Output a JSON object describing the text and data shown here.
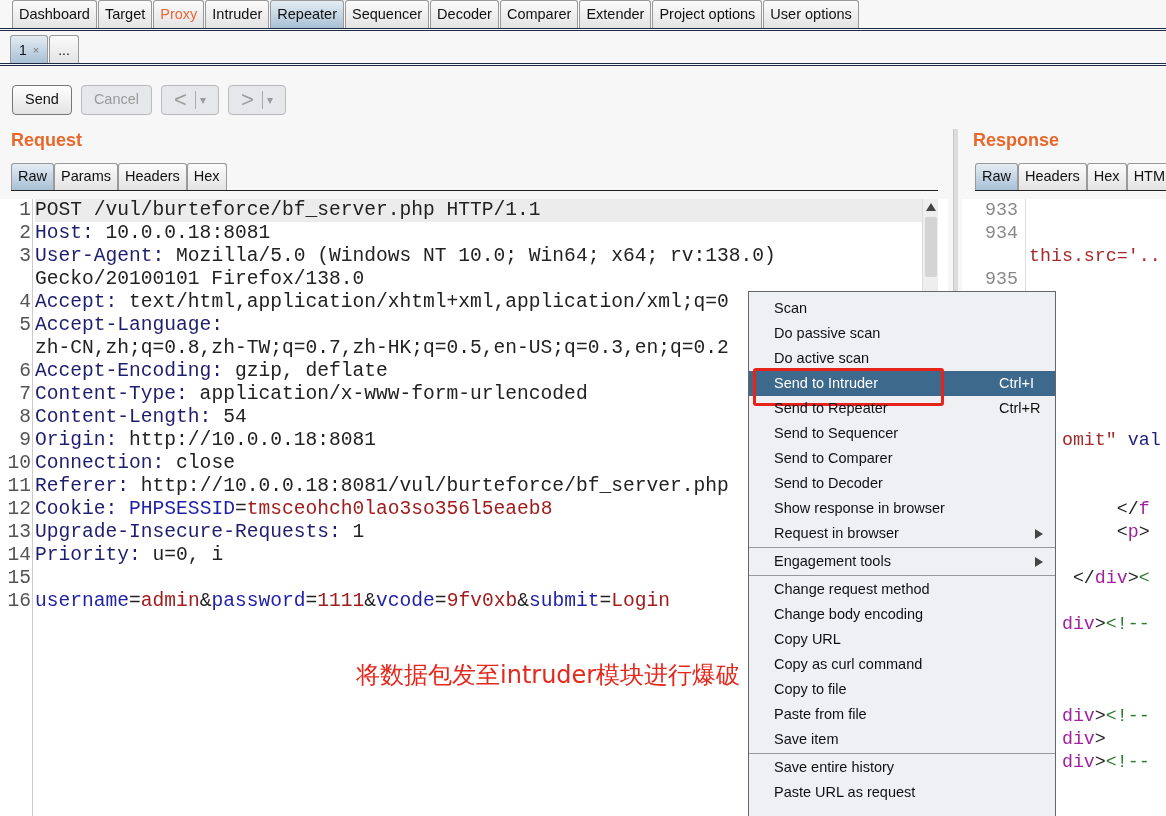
{
  "tabs": [
    {
      "label": "Dashboard",
      "selected": false,
      "highlighted": false
    },
    {
      "label": "Target",
      "selected": false,
      "highlighted": false
    },
    {
      "label": "Proxy",
      "selected": false,
      "highlighted": true
    },
    {
      "label": "Intruder",
      "selected": false,
      "highlighted": false
    },
    {
      "label": "Repeater",
      "selected": true,
      "highlighted": false
    },
    {
      "label": "Sequencer",
      "selected": false,
      "highlighted": false
    },
    {
      "label": "Decoder",
      "selected": false,
      "highlighted": false
    },
    {
      "label": "Comparer",
      "selected": false,
      "highlighted": false
    },
    {
      "label": "Extender",
      "selected": false,
      "highlighted": false
    },
    {
      "label": "Project options",
      "selected": false,
      "highlighted": false
    },
    {
      "label": "User options",
      "selected": false,
      "highlighted": false
    }
  ],
  "subtabs": [
    {
      "label": "1",
      "close": "×",
      "selected": true
    },
    {
      "label": "...",
      "selected": false
    }
  ],
  "toolbar": [
    {
      "kind": "text",
      "label": "Send",
      "disabled": false
    },
    {
      "kind": "text",
      "label": "Cancel",
      "disabled": true
    },
    {
      "kind": "split",
      "label": "<",
      "caret": "▾",
      "disabled": true
    },
    {
      "kind": "split",
      "label": ">",
      "caret": "▾",
      "disabled": true
    }
  ],
  "request": {
    "title": "Request",
    "tabs": [
      {
        "label": "Raw",
        "selected": true
      },
      {
        "label": "Params",
        "selected": false
      },
      {
        "label": "Headers",
        "selected": false
      },
      {
        "label": "Hex",
        "selected": false
      }
    ],
    "lines": [
      {
        "number": "1",
        "current": true,
        "segments": [
          {
            "kind": "plain",
            "text": "POST /vul/burteforce/bf_server.php HTTP/1.1"
          }
        ]
      },
      {
        "number": "2",
        "current": false,
        "segments": [
          {
            "kind": "header",
            "text": "Host:"
          },
          {
            "kind": "plain",
            "text": " 10.0.0.18:8081"
          }
        ]
      },
      {
        "number": "3",
        "current": false,
        "segments": [
          {
            "kind": "header",
            "text": "User-Agent:"
          },
          {
            "kind": "plain",
            "text": " Mozilla/5.0 (Windows NT 10.0; Win64; x64; rv:138.0)"
          }
        ]
      },
      {
        "current": false,
        "segments": [
          {
            "kind": "plain",
            "text": "Gecko/20100101 Firefox/138.0"
          }
        ]
      },
      {
        "number": "4",
        "current": false,
        "segments": [
          {
            "kind": "header",
            "text": "Accept:"
          },
          {
            "kind": "plain",
            "text": " text/html,application/xhtml+xml,application/xml;q=0"
          }
        ]
      },
      {
        "number": "5",
        "current": false,
        "segments": [
          {
            "kind": "header",
            "text": "Accept-Language:"
          }
        ]
      },
      {
        "current": false,
        "segments": [
          {
            "kind": "plain",
            "text": "zh-CN,zh;q=0.8,zh-TW;q=0.7,zh-HK;q=0.5,en-US;q=0.3,en;q=0.2"
          }
        ]
      },
      {
        "number": "6",
        "current": false,
        "segments": [
          {
            "kind": "header",
            "text": "Accept-Encoding:"
          },
          {
            "kind": "plain",
            "text": " gzip, deflate"
          }
        ]
      },
      {
        "number": "7",
        "current": false,
        "segments": [
          {
            "kind": "header",
            "text": "Content-Type:"
          },
          {
            "kind": "plain",
            "text": " application/x-www-form-urlencoded"
          }
        ]
      },
      {
        "number": "8",
        "current": false,
        "segments": [
          {
            "kind": "header",
            "text": "Content-Length:"
          },
          {
            "kind": "plain",
            "text": " 54"
          }
        ]
      },
      {
        "number": "9",
        "current": false,
        "segments": [
          {
            "kind": "header",
            "text": "Origin:"
          },
          {
            "kind": "plain",
            "text": " http://10.0.0.18:8081"
          }
        ]
      },
      {
        "number": "10",
        "current": false,
        "segments": [
          {
            "kind": "header",
            "text": "Connection:"
          },
          {
            "kind": "plain",
            "text": " close"
          }
        ]
      },
      {
        "number": "11",
        "current": false,
        "segments": [
          {
            "kind": "header",
            "text": "Referer:"
          },
          {
            "kind": "plain",
            "text": " http://10.0.0.18:8081/vul/burteforce/bf_server.php"
          }
        ]
      },
      {
        "number": "12",
        "current": false,
        "segments": [
          {
            "kind": "header",
            "text": "Cookie: "
          },
          {
            "kind": "param",
            "text": "PHPSESSID"
          },
          {
            "kind": "plain",
            "text": "="
          },
          {
            "kind": "value",
            "text": "tmsceohch0lao3so356l5eaeb8"
          }
        ]
      },
      {
        "number": "13",
        "current": false,
        "segments": [
          {
            "kind": "header",
            "text": "Upgrade-Insecure-Requests:"
          },
          {
            "kind": "plain",
            "text": " 1"
          }
        ]
      },
      {
        "number": "14",
        "current": false,
        "segments": [
          {
            "kind": "header",
            "text": "Priority:"
          },
          {
            "kind": "plain",
            "text": " u=0, i"
          }
        ]
      },
      {
        "number": "15",
        "current": false
      },
      {
        "number": "16",
        "current": false,
        "segments": [
          {
            "kind": "param",
            "text": "username"
          },
          {
            "kind": "plain",
            "text": "="
          },
          {
            "kind": "value",
            "text": "admin"
          },
          {
            "kind": "plain",
            "text": "&"
          },
          {
            "kind": "param",
            "text": "password"
          },
          {
            "kind": "plain",
            "text": "="
          },
          {
            "kind": "value",
            "text": "1111"
          },
          {
            "kind": "plain",
            "text": "&"
          },
          {
            "kind": "param",
            "text": "vcode"
          },
          {
            "kind": "plain",
            "text": "="
          },
          {
            "kind": "value",
            "text": "9fv0xb"
          },
          {
            "kind": "plain",
            "text": "&"
          },
          {
            "kind": "param",
            "text": "submit"
          },
          {
            "kind": "plain",
            "text": "="
          },
          {
            "kind": "value",
            "text": "Login"
          }
        ]
      }
    ]
  },
  "annotation": {
    "caption": "将数据包发至intruder模块进行爆破"
  },
  "response": {
    "title": "Response",
    "tabs": [
      {
        "label": "Raw",
        "selected": true
      },
      {
        "label": "Headers",
        "selected": false
      },
      {
        "label": "Hex",
        "selected": false
      },
      {
        "label": "HTM",
        "selected": false
      }
    ],
    "lines": [
      {
        "number": "933"
      },
      {
        "number": "934"
      },
      {
        "segments": [
          {
            "kind": "string",
            "text": "this.src='.."
          }
        ]
      },
      {
        "number": "935"
      },
      {
        "kind": "blank"
      },
      {
        "kind": "blank"
      },
      {
        "kind": "blank"
      },
      {
        "kind": "blank"
      },
      {
        "kind": "blank"
      },
      {
        "kind": "blank"
      },
      {
        "kind": "shallow",
        "segments": [
          {
            "kind": "string",
            "text": "omit\""
          },
          {
            "kind": "attr",
            "text": " val"
          }
        ]
      },
      {
        "kind": "blank"
      },
      {
        "kind": "blank"
      },
      {
        "kind": "deep",
        "segments": [
          {
            "kind": "plain",
            "text": "</"
          },
          {
            "kind": "tag",
            "text": "f"
          }
        ]
      },
      {
        "kind": "deep",
        "segments": [
          {
            "kind": "plain",
            "text": "<"
          },
          {
            "kind": "tag",
            "text": "p"
          },
          {
            "kind": "plain",
            "text": ">"
          }
        ]
      },
      {
        "kind": "blank"
      },
      {
        "kind": "mid",
        "segments": [
          {
            "kind": "plain",
            "text": "</"
          },
          {
            "kind": "tag",
            "text": "div"
          },
          {
            "kind": "plain",
            "text": ">"
          },
          {
            "kind": "comment",
            "text": "<"
          }
        ]
      },
      {
        "kind": "blank"
      },
      {
        "kind": "shallow",
        "segments": [
          {
            "kind": "tag",
            "text": "div"
          },
          {
            "kind": "plain",
            "text": ">"
          },
          {
            "kind": "comment",
            "text": "<!--"
          }
        ]
      },
      {
        "kind": "blank"
      },
      {
        "kind": "blank"
      },
      {
        "kind": "blank"
      },
      {
        "kind": "shallow",
        "segments": [
          {
            "kind": "tag",
            "text": "div"
          },
          {
            "kind": "plain",
            "text": ">"
          },
          {
            "kind": "comment",
            "text": "<!--"
          }
        ]
      },
      {
        "kind": "shallow",
        "segments": [
          {
            "kind": "tag",
            "text": "div"
          },
          {
            "kind": "plain",
            "text": ">"
          }
        ]
      },
      {
        "kind": "shallow",
        "segments": [
          {
            "kind": "tag",
            "text": "div"
          },
          {
            "kind": "plain",
            "text": ">"
          },
          {
            "kind": "comment",
            "text": "<!--"
          }
        ]
      }
    ]
  },
  "context_menu": {
    "groups": [
      {
        "items": [
          {
            "label": "Scan",
            "selected": false,
            "submenu": false,
            "annotated": false
          },
          {
            "label": "Do passive scan",
            "selected": false,
            "submenu": false,
            "annotated": false
          },
          {
            "label": "Do active scan",
            "selected": false,
            "submenu": false,
            "annotated": false
          },
          {
            "label": "Send to Intruder",
            "shortcut": "Ctrl+I",
            "selected": true,
            "submenu": false,
            "annotated": true
          },
          {
            "label": "Send to Repeater",
            "shortcut": "Ctrl+R",
            "selected": false,
            "submenu": false,
            "annotated": false
          },
          {
            "label": "Send to Sequencer",
            "selected": false,
            "submenu": false,
            "annotated": false
          },
          {
            "label": "Send to Comparer",
            "selected": false,
            "submenu": false,
            "annotated": false
          },
          {
            "label": "Send to Decoder",
            "selected": false,
            "submenu": false,
            "annotated": false
          },
          {
            "label": "Show response in browser",
            "selected": false,
            "submenu": false,
            "annotated": false
          },
          {
            "label": "Request in browser",
            "selected": false,
            "submenu": true,
            "annotated": false
          }
        ]
      },
      {
        "items": [
          {
            "label": "Engagement tools",
            "selected": false,
            "submenu": true,
            "annotated": false
          }
        ]
      },
      {
        "items": [
          {
            "label": "Change request method",
            "selected": false,
            "submenu": false,
            "annotated": false
          },
          {
            "label": "Change body encoding",
            "selected": false,
            "submenu": false,
            "annotated": false
          },
          {
            "label": "Copy URL",
            "selected": false,
            "submenu": false,
            "annotated": false
          },
          {
            "label": "Copy as curl command",
            "selected": false,
            "submenu": false,
            "annotated": false
          },
          {
            "label": "Copy to file",
            "selected": false,
            "submenu": false,
            "annotated": false
          },
          {
            "label": "Paste from file",
            "selected": false,
            "submenu": false,
            "annotated": false
          },
          {
            "label": "Save item",
            "selected": false,
            "submenu": false,
            "annotated": false
          }
        ]
      },
      {
        "items": [
          {
            "label": "Save entire history",
            "selected": false,
            "submenu": false,
            "annotated": false
          },
          {
            "label": "Paste URL as request",
            "selected": false,
            "submenu": false,
            "annotated": false
          }
        ]
      }
    ]
  }
}
